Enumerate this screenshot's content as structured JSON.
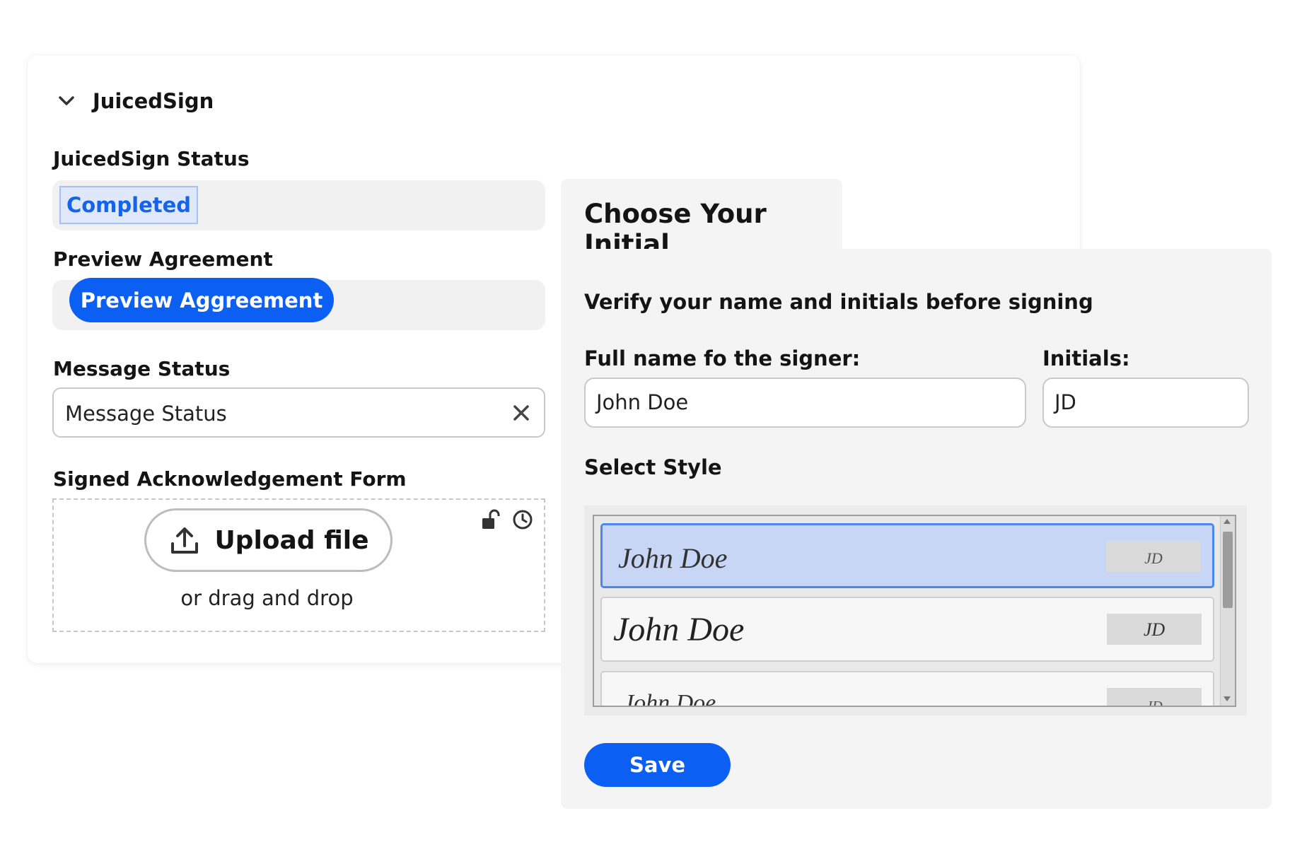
{
  "juicedsign": {
    "section_title": "JuicedSign",
    "status_label": "JuicedSign Status",
    "status_value": "Completed",
    "preview_label": "Preview Agreement",
    "preview_button": "Preview Aggreement",
    "message_label": "Message Status",
    "message_placeholder": "Message Status",
    "ack_label": "Signed Acknowledgement Form",
    "upload_button": "Upload file",
    "drag_text": "or drag and drop",
    "icons": [
      "chevron-down-icon",
      "close-icon",
      "upload-icon",
      "unlock-icon",
      "clock-icon"
    ]
  },
  "initial_dialog": {
    "title": "Choose Your Initial",
    "instructions": "Verify your name and initials before signing",
    "fullname_label": "Full name fo the signer:",
    "fullname_value": "John Doe",
    "initials_label": "Initials:",
    "initials_value": "JD",
    "style_label": "Select Style",
    "styles": [
      {
        "name": "John Doe",
        "initials": "JD",
        "selected": true
      },
      {
        "name": "John Doe",
        "initials": "JD",
        "selected": false
      },
      {
        "name": "John Doe",
        "initials": "JD",
        "selected": false
      }
    ],
    "save_button": "Save"
  },
  "colors": {
    "primary": "#0b5ff2",
    "status_text": "#1463e8",
    "status_bg": "#dfe8fb",
    "selected_style_bg": "#c7d6f5",
    "selected_style_border": "#4d86ee"
  }
}
